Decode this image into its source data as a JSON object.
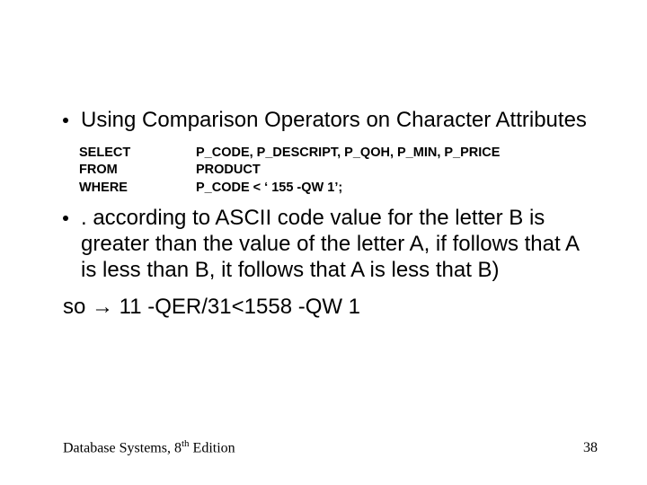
{
  "bullets": {
    "first": "Using Comparison Operators on Character Attributes",
    "second": ". according to ASCII code value for the letter B is greater than the value of the letter A, if follows that A is less than B, it follows that A is less that B)"
  },
  "sql": {
    "select_kw": "SELECT",
    "select_rest": "P_CODE, P_DESCRIPT, P_QOH, P_MIN, P_PRICE",
    "from_kw": "FROM",
    "from_rest": "PRODUCT",
    "where_kw": "WHERE",
    "where_rest": "P_CODE < ‘ 155 -QW 1’;"
  },
  "so_line_prefix": "so ",
  "arrow": "→",
  "so_line_rest": " 11 -QER/31<1558 -QW 1",
  "footer": {
    "book_prefix": "Database Systems, 8",
    "ord": "th",
    "book_suffix": " Edition",
    "page": "38"
  }
}
